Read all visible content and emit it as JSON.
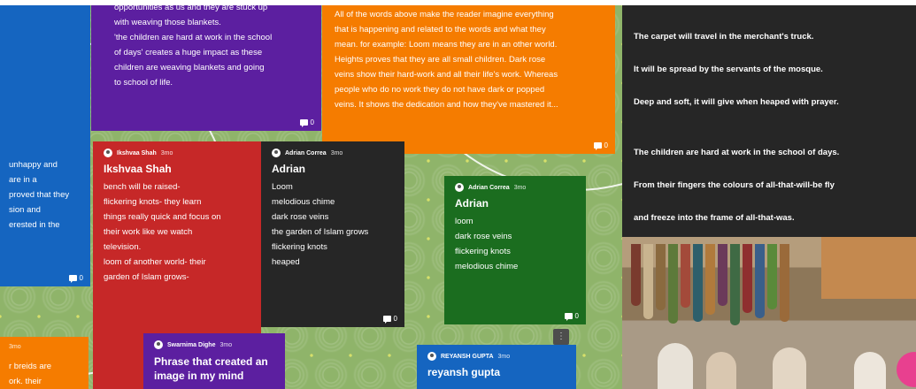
{
  "cards": {
    "purple_top": {
      "lines": [
        "opportunities as us and they are stuck up",
        "with weaving those blankets.",
        "'the children are hard at work in the school",
        "of days' creates a huge impact as these",
        "children are  weaving blankets and going",
        "to school of life."
      ],
      "comments": "0"
    },
    "orange_top": {
      "lines": [
        "All of the words above make the reader imagine everything",
        "that is happening and related to the words and what they",
        "mean. for example: Loom means they are in an other world.",
        "Heights proves that they are all small children. Dark rose",
        "veins show their hard-work and all their life's work. Whereas",
        "people who do no work they do not have dark or popped",
        "veins. It shows the dedication and how they've mastered it..."
      ],
      "comments": "0"
    },
    "blue_left": {
      "lines": [
        "unhappy and",
        "are in a",
        "proved that they",
        "sion and",
        "erested in the"
      ],
      "comments": "0"
    },
    "red": {
      "author": "Ikshvaa Shah",
      "time": "3mo",
      "title": "Ikshvaa Shah",
      "lines": [
        "bench will be raised-",
        "flickering knots- they learn",
        "things really quick and focus on",
        "their work like we watch",
        "television.",
        "loom of another world- their",
        "garden of Islam grows-"
      ]
    },
    "dark": {
      "author": "Adrian Correa",
      "time": "3mo",
      "title": "Adrian",
      "lines": [
        "Loom",
        "melodious chime",
        "dark rose veins",
        "the garden of Islam grows",
        "flickering knots",
        "heaped"
      ],
      "comments": "0"
    },
    "green": {
      "author": "Adrian Correa",
      "time": "3mo",
      "title": "Adrian",
      "lines": [
        "loom",
        "dark rose veins",
        "flickering knots",
        "melodious chime"
      ],
      "comments": "0"
    },
    "orange_bottom": {
      "time": "3mo",
      "lines": [
        "r breids are",
        "ork. their"
      ]
    },
    "purple_bottom": {
      "author": "Swarnima Dighe",
      "time": "3mo",
      "title_lines": [
        "Phrase that created an",
        "image in my mind"
      ]
    },
    "blue_bottom": {
      "author": "REYANSH GUPTA",
      "time": "3mo",
      "title": "reyansh gupta"
    }
  },
  "poem": {
    "lines": [
      "The carpet will travel in the merchant's truck.",
      "It will be spread by the servants of the mosque.",
      "Deep and soft, it will give when heaped with prayer.",
      "The children are hard at work in the school of days.",
      "From their fingers the colours of all-that-will-be fly",
      "and freeze into the frame of all-that-was."
    ]
  },
  "colors": {
    "board": "#8fb46a",
    "purple": "#5c1fa0",
    "orange": "#f57c00",
    "blue": "#1565c0",
    "red": "#c62828",
    "dark": "#262626",
    "green": "#1b6d1f",
    "fab": "#e8408f"
  },
  "icons": [
    "comment-icon",
    "avatar-icon",
    "more-vert-icon",
    "add-post-fab-icon"
  ]
}
